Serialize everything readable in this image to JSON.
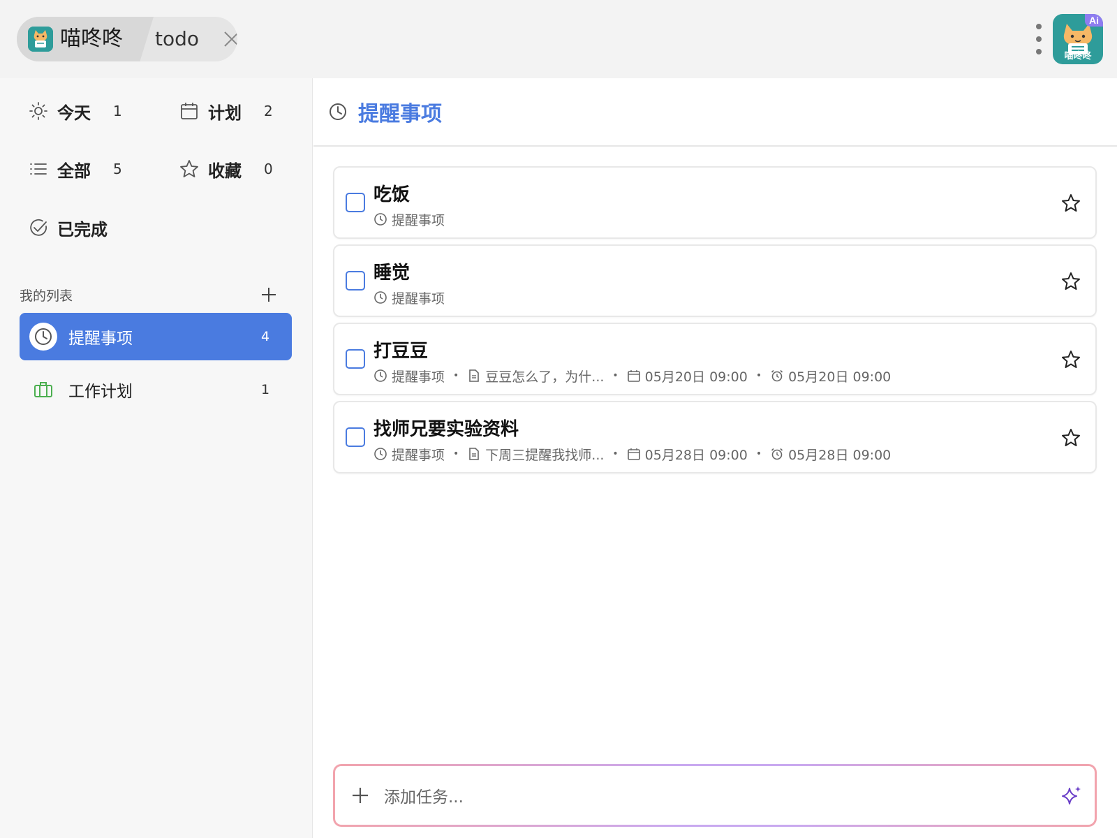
{
  "app": {
    "name": "喵咚咚",
    "tab_label": "todo",
    "ai_badge": "Ai",
    "logo_text": "喵咚咚"
  },
  "sidebar": {
    "smart_lists": [
      {
        "label": "今天",
        "count": "1",
        "icon": "sun-icon"
      },
      {
        "label": "计划",
        "count": "2",
        "icon": "calendar-icon"
      },
      {
        "label": "全部",
        "count": "5",
        "icon": "list-icon"
      },
      {
        "label": "收藏",
        "count": "0",
        "icon": "star-icon"
      },
      {
        "label": "已完成",
        "count": "",
        "icon": "check-circle-icon"
      }
    ],
    "section_title": "我的列表",
    "lists": [
      {
        "label": "提醒事项",
        "count": "4",
        "icon": "clock-icon",
        "active": true
      },
      {
        "label": "工作计划",
        "count": "1",
        "icon": "briefcase-icon",
        "active": false
      }
    ]
  },
  "main": {
    "title": "提醒事项",
    "tasks": [
      {
        "name": "吃饭",
        "list": "提醒事项",
        "note": "",
        "due": "",
        "reminder": ""
      },
      {
        "name": "睡觉",
        "list": "提醒事项",
        "note": "",
        "due": "",
        "reminder": ""
      },
      {
        "name": "打豆豆",
        "list": "提醒事项",
        "note": "豆豆怎么了，为什...",
        "due": "05月20日 09:00",
        "reminder": "05月20日 09:00"
      },
      {
        "name": "找师兄要实验资料",
        "list": "提醒事项",
        "note": "下周三提醒我找师...",
        "due": "05月28日 09:00",
        "reminder": "05月28日 09:00"
      }
    ],
    "add_placeholder": "添加任务..."
  },
  "colors": {
    "accent": "#4a7be0",
    "logo_bg": "#2e9c9a",
    "ai_badge": "#8e7cf0",
    "work_list": "#4caf50",
    "sparkle": "#6a3fc8"
  }
}
